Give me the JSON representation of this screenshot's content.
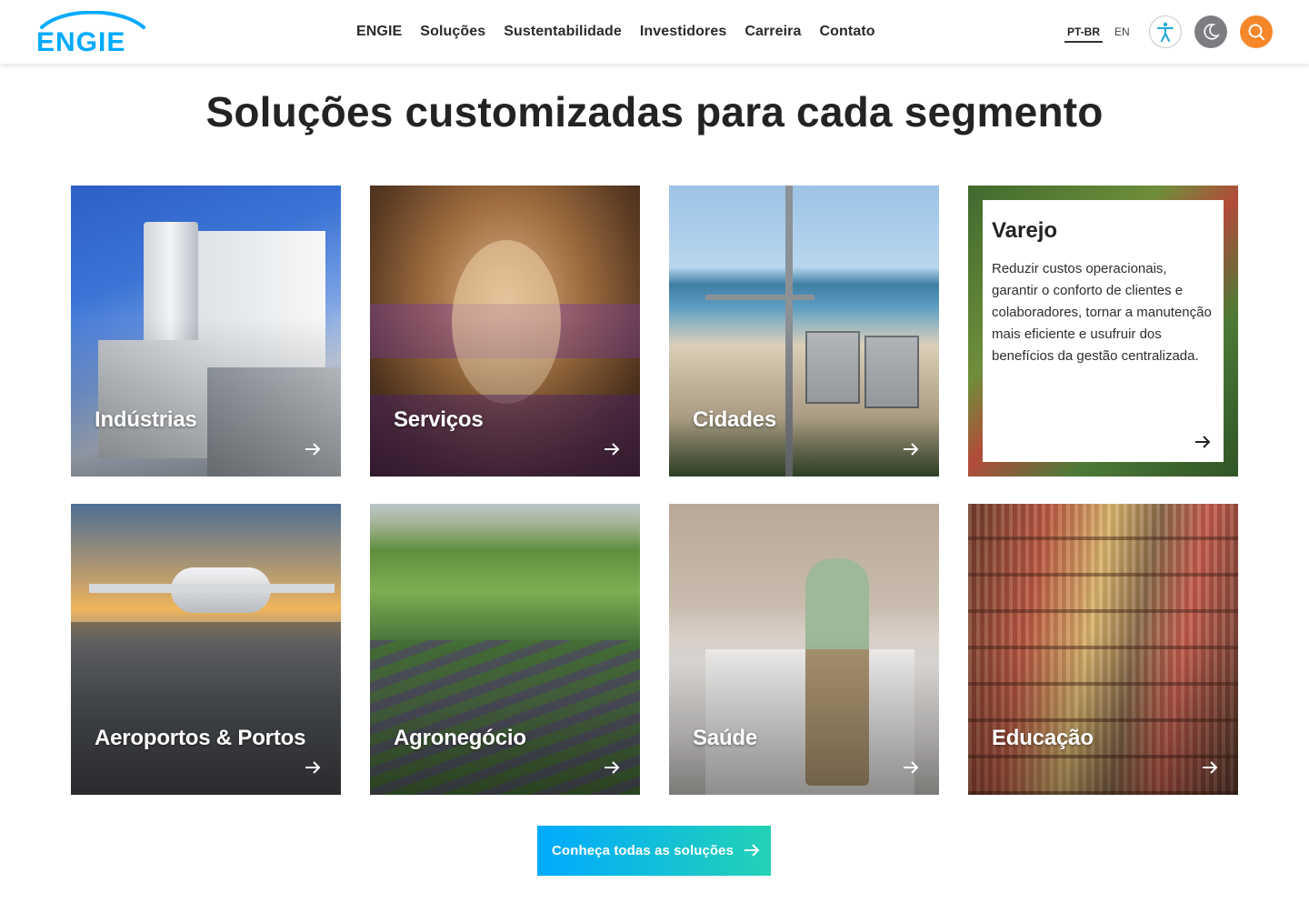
{
  "brand": {
    "logo_text": "ENGIE",
    "color": "#00aaff"
  },
  "nav": {
    "items": [
      "ENGIE",
      "Soluções",
      "Sustentabilidade",
      "Investidores",
      "Carreira",
      "Contato"
    ]
  },
  "language": {
    "active": "PT-BR",
    "other": "EN"
  },
  "controls": {
    "accessibility_icon": "accessibility-icon",
    "dark_mode_icon": "moon-icon",
    "search_icon": "search-icon",
    "accent": "#f5872a"
  },
  "page": {
    "title": "Soluções customizadas para cada segmento"
  },
  "segments": [
    {
      "label": "Indústrias"
    },
    {
      "label": "Serviços"
    },
    {
      "label": "Cidades"
    },
    {
      "label": "Varejo",
      "description": "Reduzir custos operacionais, garantir o conforto de clientes e colaboradores, tornar a manutenção mais eficiente e usufruir dos benefícios da gestão centralizada."
    },
    {
      "label": "Aeroportos & Portos"
    },
    {
      "label": "Agronegócio"
    },
    {
      "label": "Saúde"
    },
    {
      "label": "Educação"
    }
  ],
  "cta": {
    "label": "Conheça todas as soluções",
    "gradient": [
      "#00aaff",
      "#23d2b5"
    ]
  }
}
